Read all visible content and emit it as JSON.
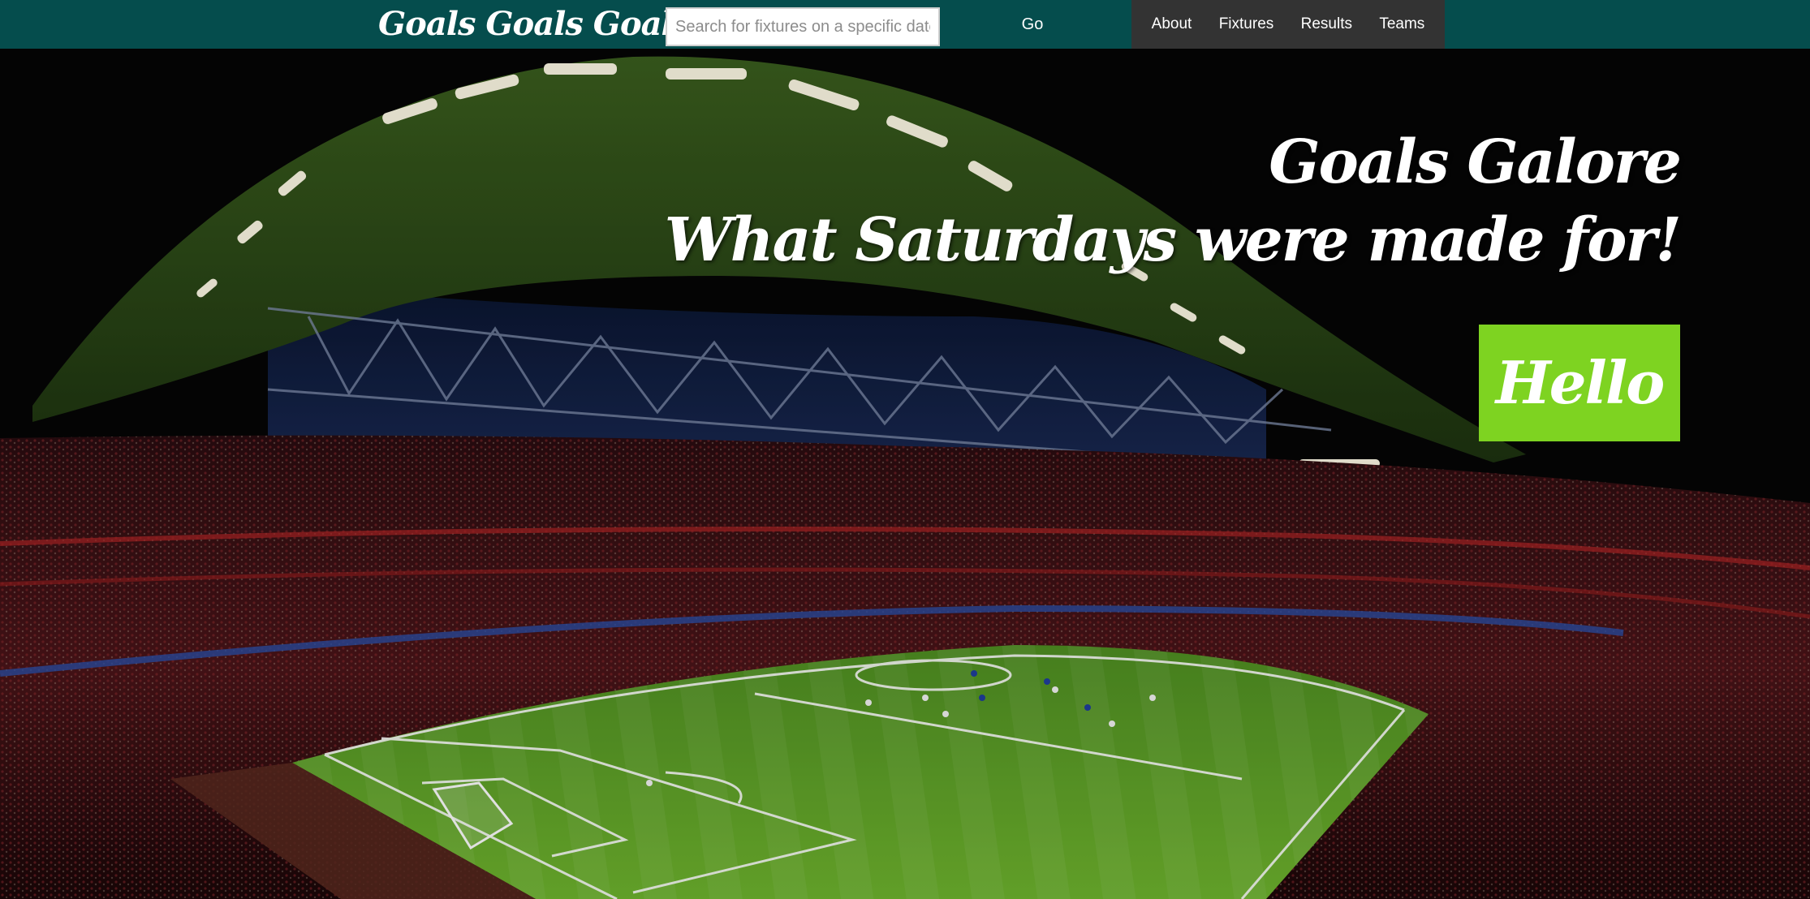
{
  "navbar": {
    "brand": "Goals Goals Goals",
    "search": {
      "placeholder": "Search for fixtures on a specific date",
      "value": ""
    },
    "go_label": "Go",
    "links": [
      {
        "label": "About"
      },
      {
        "label": "Fixtures"
      },
      {
        "label": "Results"
      },
      {
        "label": "Teams"
      }
    ]
  },
  "hero": {
    "title_line1": "Goals Galore",
    "title_line2": "What Saturdays were made for!",
    "button_label": "Hello",
    "background_image": "night-football-stadium-photo"
  },
  "colors": {
    "navbar_bg": "#054d4d",
    "nav_links_bg": "#333333",
    "accent_button": "#7ed321",
    "text": "#ffffff"
  }
}
